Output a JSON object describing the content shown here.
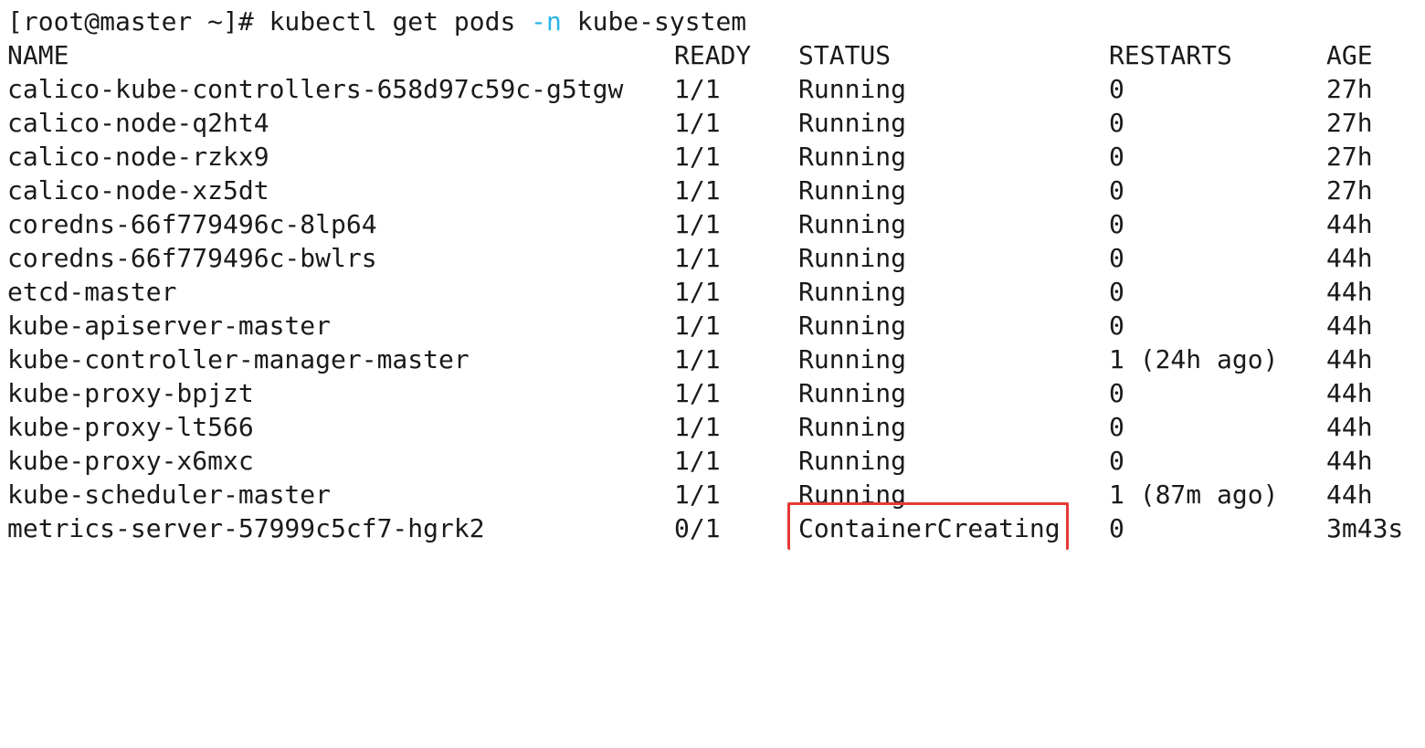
{
  "prompt": {
    "user_host": "[root@master ~]#",
    "command": "kubectl get pods",
    "flag": "-n",
    "namespace": "kube-system"
  },
  "table": {
    "headers": {
      "name": "NAME",
      "ready": "READY",
      "status": "STATUS",
      "restarts": "RESTARTS",
      "age": "AGE"
    },
    "rows": [
      {
        "name": "calico-kube-controllers-658d97c59c-g5tgw",
        "ready": "1/1",
        "status": "Running",
        "restarts": "0",
        "age": "27h"
      },
      {
        "name": "calico-node-q2ht4",
        "ready": "1/1",
        "status": "Running",
        "restarts": "0",
        "age": "27h"
      },
      {
        "name": "calico-node-rzkx9",
        "ready": "1/1",
        "status": "Running",
        "restarts": "0",
        "age": "27h"
      },
      {
        "name": "calico-node-xz5dt",
        "ready": "1/1",
        "status": "Running",
        "restarts": "0",
        "age": "27h"
      },
      {
        "name": "coredns-66f779496c-8lp64",
        "ready": "1/1",
        "status": "Running",
        "restarts": "0",
        "age": "44h"
      },
      {
        "name": "coredns-66f779496c-bwlrs",
        "ready": "1/1",
        "status": "Running",
        "restarts": "0",
        "age": "44h"
      },
      {
        "name": "etcd-master",
        "ready": "1/1",
        "status": "Running",
        "restarts": "0",
        "age": "44h"
      },
      {
        "name": "kube-apiserver-master",
        "ready": "1/1",
        "status": "Running",
        "restarts": "0",
        "age": "44h"
      },
      {
        "name": "kube-controller-manager-master",
        "ready": "1/1",
        "status": "Running",
        "restarts": "1 (24h ago)",
        "age": "44h"
      },
      {
        "name": "kube-proxy-bpjzt",
        "ready": "1/1",
        "status": "Running",
        "restarts": "0",
        "age": "44h"
      },
      {
        "name": "kube-proxy-lt566",
        "ready": "1/1",
        "status": "Running",
        "restarts": "0",
        "age": "44h"
      },
      {
        "name": "kube-proxy-x6mxc",
        "ready": "1/1",
        "status": "Running",
        "restarts": "0",
        "age": "44h"
      },
      {
        "name": "kube-scheduler-master",
        "ready": "1/1",
        "status": "Running",
        "restarts": "1 (87m ago)",
        "age": "44h"
      },
      {
        "name": "metrics-server-57999c5cf7-hgrk2",
        "ready": "0/1",
        "status": "ContainerCreating",
        "restarts": "0",
        "age": "3m43s"
      }
    ]
  },
  "colors": {
    "text": "#1a1a1a",
    "flag": "#2bb3e6",
    "highlight": "#e53935",
    "background": "#ffffff"
  }
}
